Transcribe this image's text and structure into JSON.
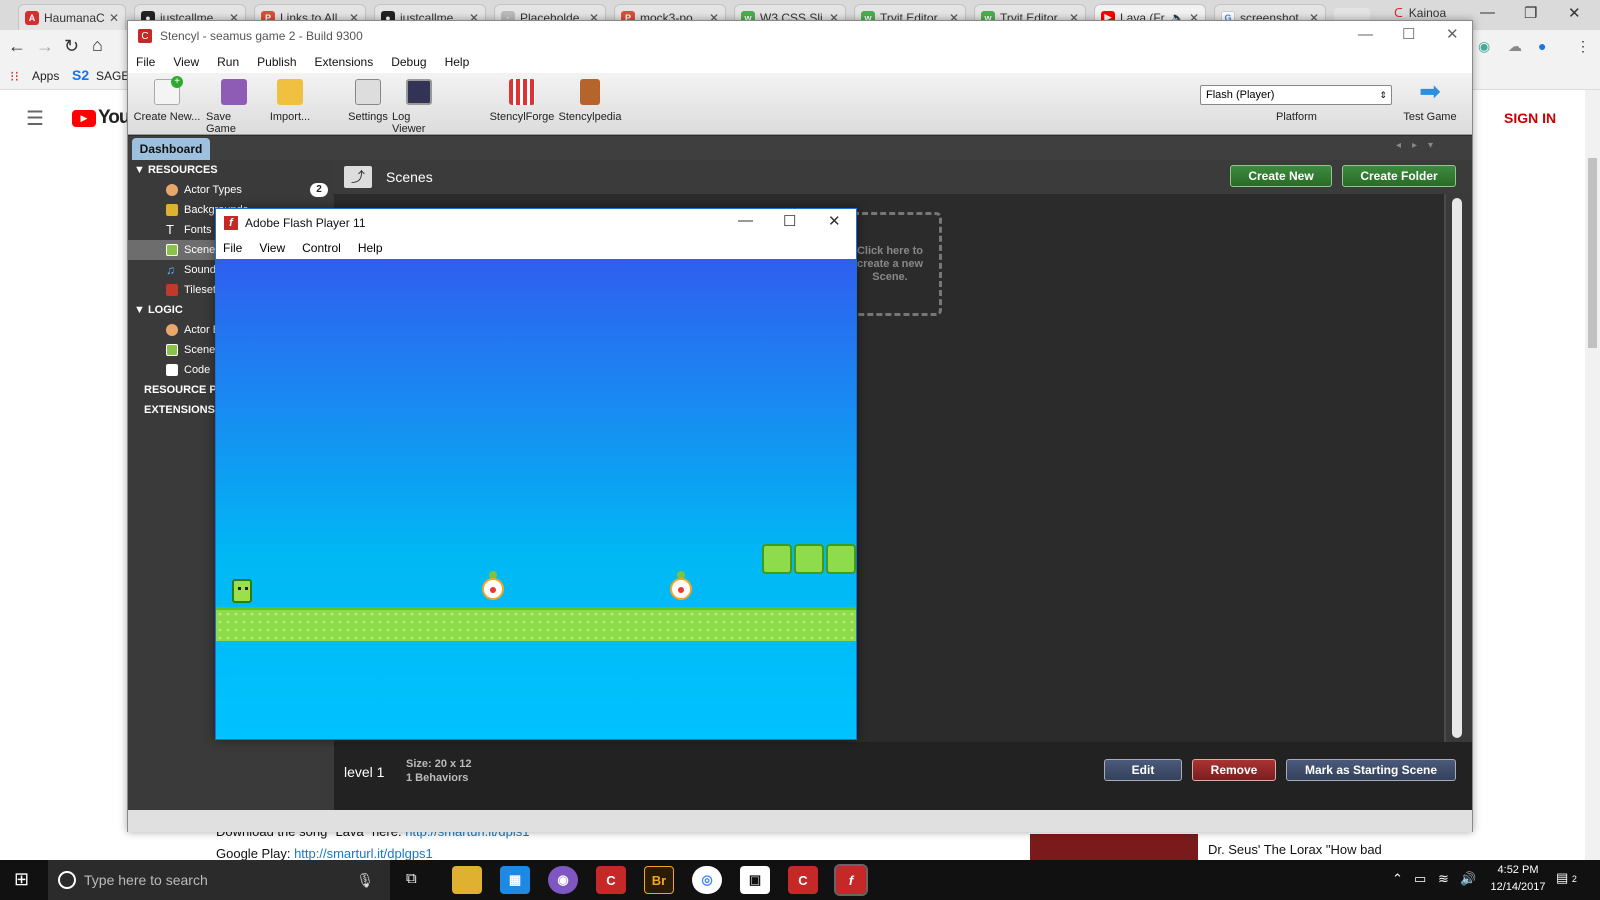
{
  "browser": {
    "tabs": [
      {
        "label": "HaumanaC",
        "icon": "angular-icon",
        "color": "#d32f2f"
      },
      {
        "label": "justcallme",
        "icon": "github-icon",
        "color": "#222222"
      },
      {
        "label": "Links to All",
        "icon": "pdf-icon",
        "color": "#e24b3b"
      },
      {
        "label": "justcallme",
        "icon": "github-icon",
        "color": "#222222"
      },
      {
        "label": "Placeholde",
        "icon": "placeholder-icon",
        "color": "#bbbbbb"
      },
      {
        "label": "mock3-po",
        "icon": "pdf-icon",
        "color": "#e24b3b"
      },
      {
        "label": "W3.CSS Sli",
        "icon": "w3-icon",
        "color": "#4caf50"
      },
      {
        "label": "Tryit Editor",
        "icon": "w3-icon",
        "color": "#4caf50"
      },
      {
        "label": "Tryit Editor",
        "icon": "w3-icon",
        "color": "#4caf50"
      },
      {
        "label": "Lava (Fr",
        "icon": "youtube-icon",
        "color": "#ff0000"
      },
      {
        "label": "screenshot",
        "icon": "google-icon",
        "color": "#4285f4"
      }
    ],
    "profile": "Kainoa",
    "bookmarks": {
      "apps": "Apps",
      "sage": "SAGE"
    },
    "youtube": {
      "logo": "YouT",
      "sign_in": "SIGN IN"
    },
    "below": {
      "line1": "Download the song \"Lava\" here:",
      "link1": "http://smarturl.it/dpis1",
      "line2": "Google Play:",
      "link2": "http://smarturl.it/dplgps1",
      "side_video": "Dr. Seus' The Lorax \"How bad"
    }
  },
  "stencyl": {
    "title": "Stencyl - seamus game 2 - Build 9300",
    "menu": [
      "File",
      "View",
      "Run",
      "Publish",
      "Extensions",
      "Debug",
      "Help"
    ],
    "toolbar": {
      "create_new": "Create New...",
      "save_game": "Save Game",
      "import": "Import...",
      "settings": "Settings",
      "log_viewer": "Log Viewer",
      "forge": "StencylForge",
      "pedia": "Stencylpedia",
      "platform_value": "Flash (Player)",
      "platform_label": "Platform",
      "test_game": "Test Game"
    },
    "tab": "Dashboard",
    "sidebar": {
      "resources": "RESOURCES",
      "actor_types": "Actor Types",
      "actor_count": "2",
      "backgrounds": "Backgrounds",
      "fonts": "Fonts",
      "scenes": "Scenes",
      "sounds": "Sounds",
      "tilesets": "Tilesets",
      "logic": "LOGIC",
      "actor_behaviors": "Actor Behaviors",
      "scene_behaviors": "Scene Behaviors",
      "code": "Code",
      "resource_packs": "RESOURCE PACKS",
      "extensions": "EXTENSIONS"
    },
    "main": {
      "heading": "Scenes",
      "create_new": "Create New",
      "create_folder": "Create Folder",
      "new_scene_hint": "Click here to create a new Scene."
    },
    "footer": {
      "scene_name": "level 1",
      "size": "Size: 20 x 12",
      "behaviors": "1 Behaviors",
      "edit": "Edit",
      "remove": "Remove",
      "mark_start": "Mark as Starting Scene"
    }
  },
  "flash": {
    "title": "Adobe Flash Player 11",
    "menu": [
      "File",
      "View",
      "Control",
      "Help"
    ]
  },
  "taskbar": {
    "search": "Type here to search",
    "time": "4:52 PM",
    "date": "12/14/2017",
    "notifications": "2"
  }
}
